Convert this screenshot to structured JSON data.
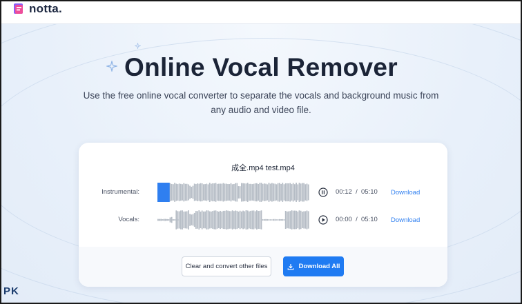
{
  "brand": {
    "name": "notta."
  },
  "hero": {
    "title": "Online Vocal Remover",
    "subtitle": "Use the free online vocal converter to separate the vocals and background music from any audio and video file."
  },
  "card": {
    "file_name": "成全.mp4 test.mp4",
    "tracks": [
      {
        "label": "Instrumental:",
        "current_time": "00:12",
        "separator": "/",
        "total_time": "05:10",
        "state": "playing",
        "progress": 0.04,
        "download_label": "Download"
      },
      {
        "label": "Vocals:",
        "current_time": "00:00",
        "separator": "/",
        "total_time": "05:10",
        "state": "paused",
        "progress": 0.0,
        "download_label": "Download"
      }
    ],
    "clear_button_label": "Clear and convert other files",
    "download_all_label": "Download All"
  },
  "watermark": {
    "text": "PK"
  },
  "colors": {
    "accent": "#1f7bf2",
    "waveform": "#b5bcc5",
    "progress": "#2f7ff0",
    "title": "#1b2437"
  }
}
